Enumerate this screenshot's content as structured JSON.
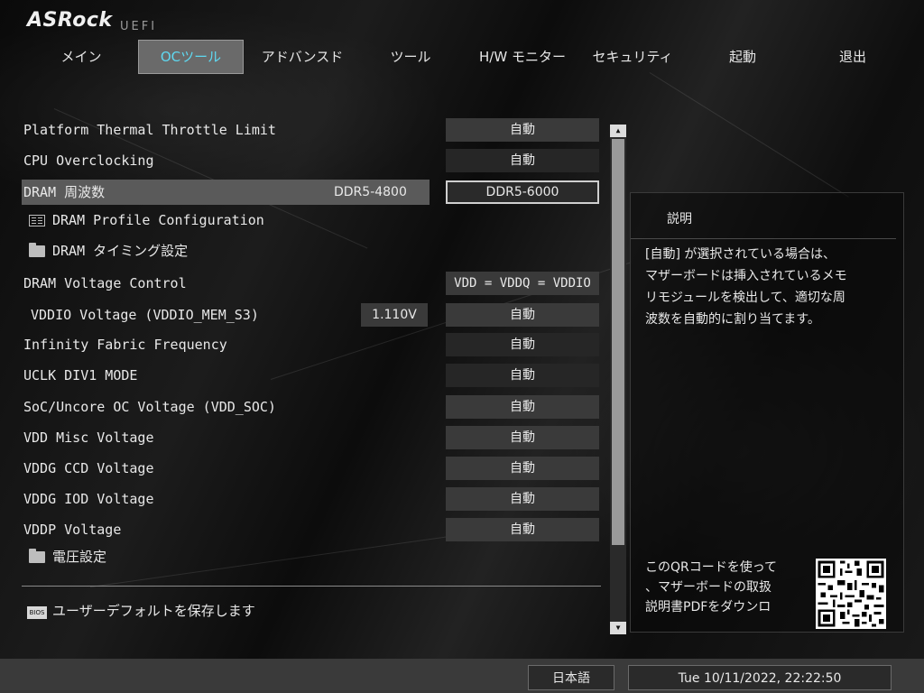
{
  "brand": {
    "logo": "ASRock",
    "sub": "UEFI"
  },
  "tabs": [
    {
      "label": "メイン"
    },
    {
      "label": "OCツール"
    },
    {
      "label": "アドバンスド"
    },
    {
      "label": "ツール"
    },
    {
      "label": "H/W モニター"
    },
    {
      "label": "セキュリティ"
    },
    {
      "label": "起動"
    },
    {
      "label": "退出"
    }
  ],
  "active_tab": "OCツール",
  "settings": [
    {
      "label": "Platform Thermal Throttle Limit",
      "value": "自動"
    },
    {
      "label": "CPU Overclocking",
      "value": "自動"
    },
    {
      "label": "DRAM 周波数",
      "current": "DDR5-4800",
      "value": "DDR5-6000"
    },
    {
      "label": "DRAM Profile Configuration"
    },
    {
      "label": "DRAM タイミング設定"
    },
    {
      "label": "DRAM Voltage Control",
      "value": "VDD = VDDQ = VDDIO"
    },
    {
      "label": "VDDIO Voltage (VDDIO_MEM_S3)",
      "number": "1.110V",
      "value": "自動"
    },
    {
      "label": "Infinity Fabric Frequency",
      "value": "自動"
    },
    {
      "label": "UCLK DIV1 MODE",
      "value": "自動"
    },
    {
      "label": "SoC/Uncore OC Voltage (VDD_SOC)",
      "value": "自動"
    },
    {
      "label": "VDD Misc Voltage",
      "value": "自動"
    },
    {
      "label": "VDDG CCD Voltage",
      "value": "自動"
    },
    {
      "label": "VDDG IOD Voltage",
      "value": "自動"
    },
    {
      "label": "VDDP Voltage",
      "value": "自動"
    },
    {
      "label": "電圧設定"
    }
  ],
  "save_default": {
    "label": "ユーザーデフォルトを保存します",
    "icon": "bios-icon"
  },
  "description": {
    "title": "説明",
    "text": "[自動] が選択されている場合は、\nマザーボードは挿入されているメモ\nリモジュールを検出して、適切な周\n波数を自動的に割り当てます。",
    "qr_text": "このQRコードを使って\n、マザーボードの取扱\n説明書PDFをダウンロ"
  },
  "scrollbar": {
    "up": "▲",
    "down": "▼"
  },
  "footer": {
    "language": "日本語",
    "datetime": "Tue 10/11/2022, 22:22:50"
  }
}
